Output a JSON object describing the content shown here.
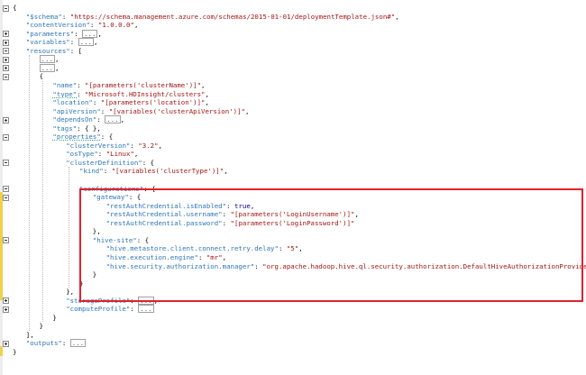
{
  "editor": {
    "lines": [
      {
        "fold": "minus",
        "indent": 0,
        "tokens": [
          [
            "p",
            "{"
          ]
        ]
      },
      {
        "indent": 1,
        "tokens": [
          [
            "k",
            "\"$schema\""
          ],
          [
            "p",
            ": "
          ],
          [
            "s",
            "\"https://schema.management.azure.com/schemas/2015-01-01/deploymentTemplate.json#\""
          ],
          [
            "p",
            ","
          ]
        ]
      },
      {
        "indent": 1,
        "tokens": [
          [
            "k",
            "\"contentVersion\""
          ],
          [
            "p",
            ": "
          ],
          [
            "s",
            "\"1.0.0.0\""
          ],
          [
            "p",
            ","
          ]
        ]
      },
      {
        "fold": "plus",
        "indent": 1,
        "tokens": [
          [
            "k",
            "\"parameters\""
          ],
          [
            "p",
            ": "
          ],
          [
            "c",
            "..."
          ],
          [
            "p",
            ","
          ]
        ]
      },
      {
        "fold": "plus",
        "indent": 1,
        "tokens": [
          [
            "k",
            "\"variables\""
          ],
          [
            "p",
            ": "
          ],
          [
            "c",
            "..."
          ],
          [
            "p",
            ","
          ]
        ]
      },
      {
        "fold": "minus",
        "indent": 1,
        "tokens": [
          [
            "k",
            "\"resources\""
          ],
          [
            "p",
            ": ["
          ]
        ]
      },
      {
        "fold": "plus",
        "indent": 2,
        "tokens": [
          [
            "c",
            "..."
          ],
          [
            "p",
            ","
          ]
        ]
      },
      {
        "fold": "plus",
        "indent": 2,
        "tokens": [
          [
            "c",
            "..."
          ],
          [
            "p",
            ","
          ]
        ]
      },
      {
        "fold": "minus",
        "indent": 2,
        "tokens": [
          [
            "p",
            "{"
          ]
        ]
      },
      {
        "indent": 3,
        "tokens": [
          [
            "k",
            "\"name\""
          ],
          [
            "p",
            ": "
          ],
          [
            "s",
            "\"[parameters('clusterName')]\""
          ],
          [
            "p",
            ","
          ]
        ]
      },
      {
        "indent": 3,
        "tokens": [
          [
            "k",
            "\"type\"",
            "u"
          ],
          [
            "p",
            ": "
          ],
          [
            "s",
            "\"Microsoft.HDInsight/clusters\""
          ],
          [
            "p",
            ","
          ]
        ]
      },
      {
        "indent": 3,
        "tokens": [
          [
            "k",
            "\"location\""
          ],
          [
            "p",
            ": "
          ],
          [
            "s",
            "\"[parameters('location')]\""
          ],
          [
            "p",
            ","
          ]
        ]
      },
      {
        "indent": 3,
        "tokens": [
          [
            "k",
            "\"apiVersion\""
          ],
          [
            "p",
            ": "
          ],
          [
            "s",
            "\"[variables('clusterApiVersion')]\""
          ],
          [
            "p",
            ","
          ]
        ]
      },
      {
        "fold": "plus",
        "indent": 3,
        "tokens": [
          [
            "k",
            "\"dependsOn\""
          ],
          [
            "p",
            ": "
          ],
          [
            "c",
            "..."
          ],
          [
            "p",
            ","
          ]
        ]
      },
      {
        "indent": 3,
        "tokens": [
          [
            "k",
            "\"tags\""
          ],
          [
            "p",
            ": { },"
          ]
        ]
      },
      {
        "fold": "minus",
        "indent": 3,
        "tokens": [
          [
            "k",
            "\"properties\"",
            "u"
          ],
          [
            "p",
            ": {"
          ]
        ]
      },
      {
        "indent": 4,
        "tokens": [
          [
            "k",
            "\"clusterVersion\""
          ],
          [
            "p",
            ": "
          ],
          [
            "s",
            "\"3.2\""
          ],
          [
            "p",
            ","
          ]
        ]
      },
      {
        "indent": 4,
        "tokens": [
          [
            "k",
            "\"osType\""
          ],
          [
            "p",
            ": "
          ],
          [
            "s",
            "\"Linux\""
          ],
          [
            "p",
            ","
          ]
        ]
      },
      {
        "fold": "minus",
        "indent": 4,
        "tokens": [
          [
            "k",
            "\"clusterDefinition\""
          ],
          [
            "p",
            ": {"
          ]
        ]
      },
      {
        "indent": 5,
        "tokens": [
          [
            "k",
            "\"kind\""
          ],
          [
            "p",
            ": "
          ],
          [
            "s",
            "\"[variables('clusterType')]\""
          ],
          [
            "p",
            ","
          ]
        ]
      },
      {
        "indent": 0,
        "tokens": []
      },
      {
        "fold": "minus",
        "indent": 5,
        "tokens": [
          [
            "k",
            "\"configurations\""
          ],
          [
            "p",
            ": {"
          ]
        ]
      },
      {
        "fold": "minus",
        "indent": 6,
        "tokens": [
          [
            "k",
            "\"gateway\""
          ],
          [
            "p",
            ": {"
          ]
        ]
      },
      {
        "indent": 7,
        "tokens": [
          [
            "k",
            "\"restAuthCredential.isEnabled\""
          ],
          [
            "p",
            ": "
          ],
          [
            "n",
            "true"
          ],
          [
            "p",
            ","
          ]
        ]
      },
      {
        "indent": 7,
        "tokens": [
          [
            "k",
            "\"restAuthCredential.username\""
          ],
          [
            "p",
            ": "
          ],
          [
            "s",
            "\"[parameters('LoginUsername')]\""
          ],
          [
            "p",
            ","
          ]
        ]
      },
      {
        "indent": 7,
        "tokens": [
          [
            "k",
            "\"restAuthCredential.password\""
          ],
          [
            "p",
            ": "
          ],
          [
            "s",
            "\"[parameters('LoginPassword')]\""
          ]
        ]
      },
      {
        "indent": 6,
        "tokens": [
          [
            "p",
            "},"
          ]
        ]
      },
      {
        "fold": "minus",
        "indent": 6,
        "tokens": [
          [
            "k",
            "\"hive-site\""
          ],
          [
            "p",
            ": {"
          ]
        ]
      },
      {
        "indent": 7,
        "tokens": [
          [
            "k",
            "\"hive.metastore.client.connect.retry.delay\""
          ],
          [
            "p",
            ": "
          ],
          [
            "s",
            "\"5\""
          ],
          [
            "p",
            ","
          ]
        ]
      },
      {
        "indent": 7,
        "tokens": [
          [
            "k",
            "\"hive.execution.engine\""
          ],
          [
            "p",
            ": "
          ],
          [
            "s",
            "\"mr\""
          ],
          [
            "p",
            ","
          ]
        ]
      },
      {
        "indent": 7,
        "tokens": [
          [
            "k",
            "\"hive.security.authorization.manager\""
          ],
          [
            "p",
            ": "
          ],
          [
            "s",
            "\"org.apache.hadoop.hive.ql.security.authorization.DefaultHiveAuthorizationProvider\""
          ]
        ]
      },
      {
        "indent": 6,
        "tokens": [
          [
            "p",
            "}"
          ]
        ]
      },
      {
        "indent": 5,
        "tokens": [
          [
            "p",
            "}"
          ]
        ]
      },
      {
        "indent": 4,
        "tokens": [
          [
            "p",
            "},"
          ]
        ]
      },
      {
        "fold": "plus",
        "indent": 4,
        "tokens": [
          [
            "k",
            "\"storageProfile\""
          ],
          [
            "p",
            ": "
          ],
          [
            "c",
            "..."
          ],
          [
            "p",
            ","
          ]
        ]
      },
      {
        "fold": "plus",
        "indent": 4,
        "tokens": [
          [
            "k",
            "\"computeProfile\""
          ],
          [
            "p",
            ": "
          ],
          [
            "c",
            "..."
          ]
        ]
      },
      {
        "indent": 3,
        "tokens": [
          [
            "p",
            "}"
          ]
        ]
      },
      {
        "indent": 2,
        "tokens": [
          [
            "p",
            "}"
          ]
        ]
      },
      {
        "indent": 1,
        "tokens": [
          [
            "p",
            "],"
          ]
        ]
      },
      {
        "fold": "plus",
        "indent": 1,
        "tokens": [
          [
            "k",
            "\"outputs\""
          ],
          [
            "p",
            ": "
          ],
          [
            "c",
            "..."
          ]
        ]
      },
      {
        "indent": 0,
        "tokens": [
          [
            "p",
            "}"
          ]
        ]
      }
    ]
  },
  "highlight": {
    "color": "#e4202c",
    "covers": "configurations"
  },
  "colors": {
    "key": "#2e75b6",
    "string": "#a31515",
    "literal": "#00008b",
    "gutter_change": "#f2d04a"
  }
}
